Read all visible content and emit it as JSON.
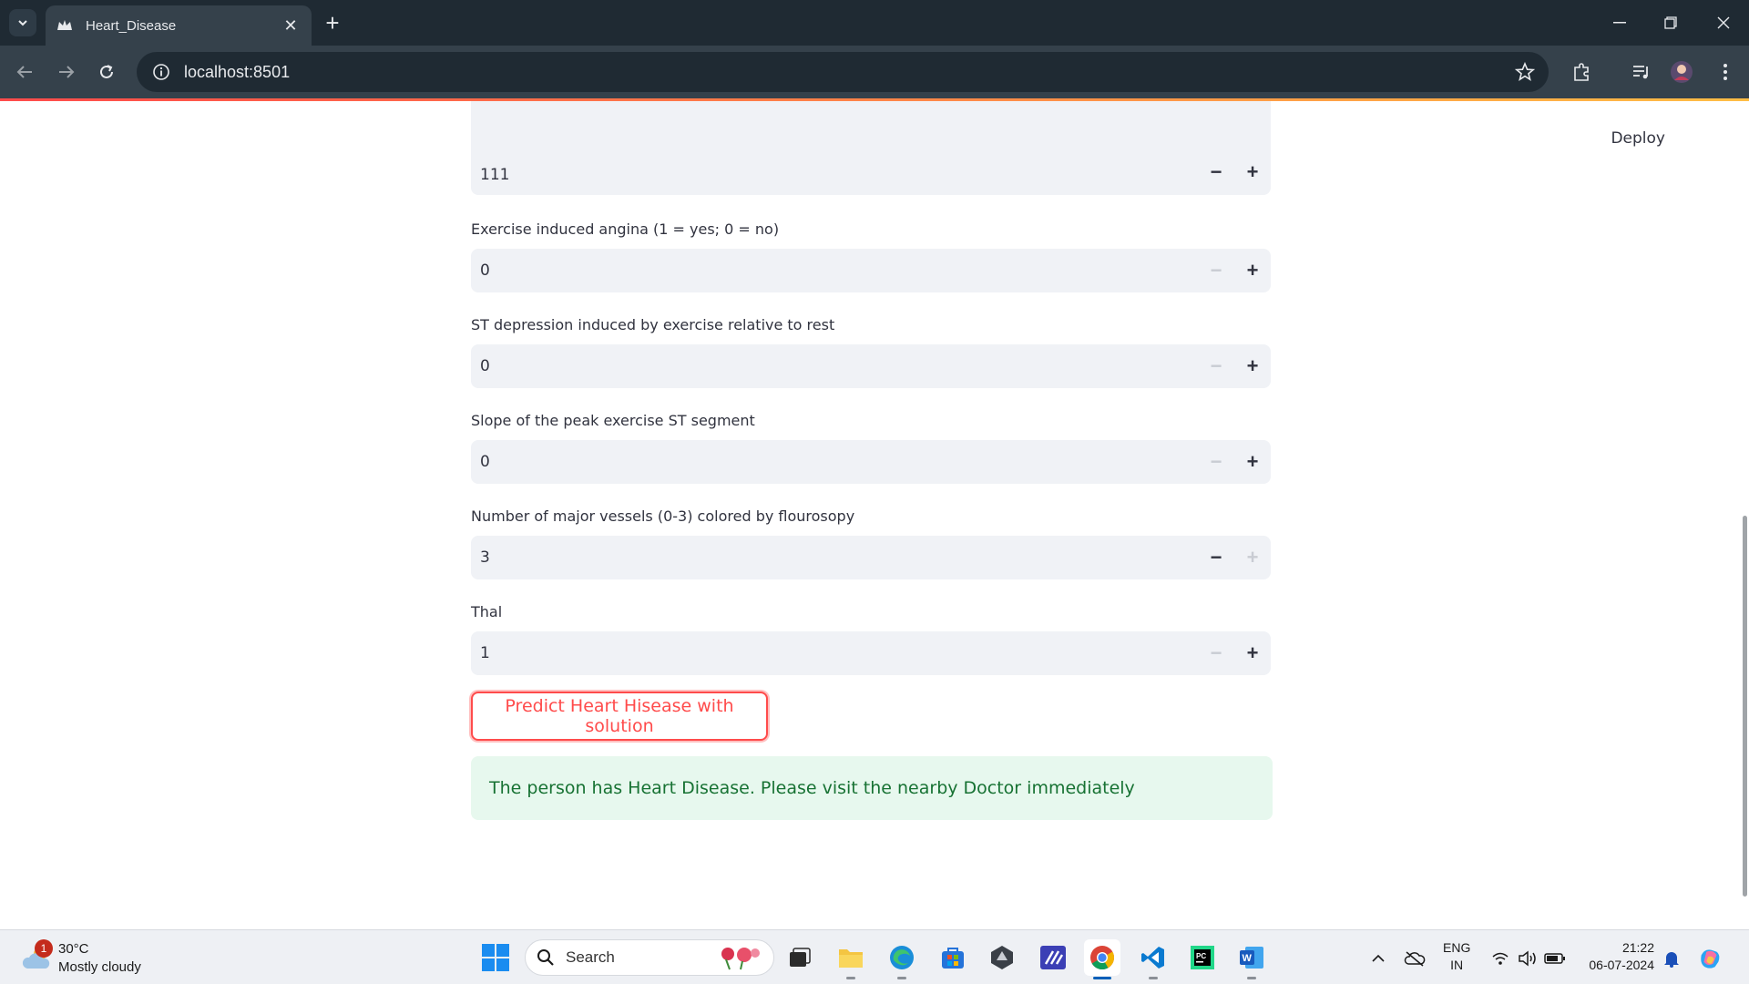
{
  "browser": {
    "tab_title": "Heart_Disease",
    "url": "localhost:8501"
  },
  "app": {
    "deploy_label": "Deploy",
    "top_input_value": "111",
    "fields": [
      {
        "label": "Exercise induced angina (1 = yes; 0 = no)",
        "value": "0",
        "minus_disabled": true,
        "plus_disabled": false
      },
      {
        "label": "ST depression induced by exercise relative to rest",
        "value": "0",
        "minus_disabled": true,
        "plus_disabled": false
      },
      {
        "label": "Slope of the peak exercise ST segment",
        "value": "0",
        "minus_disabled": true,
        "plus_disabled": false
      },
      {
        "label": "Number of major vessels (0-3) colored by flourosopy",
        "value": "3",
        "minus_disabled": false,
        "plus_disabled": true
      },
      {
        "label": "Thal",
        "value": "1",
        "minus_disabled": true,
        "plus_disabled": false
      }
    ],
    "predict_button_label": "Predict Heart Hisease with solution",
    "result_message": "The person has Heart Disease. Please visit the nearby Doctor immediately",
    "accent_color": "#ff4b4b",
    "success_bg": "#e7f8ee",
    "success_text": "#177233"
  },
  "taskbar": {
    "weather_badge": "1",
    "weather_temp": "30°C",
    "weather_condition": "Mostly cloudy",
    "search_placeholder": "Search",
    "lang_line1": "ENG",
    "lang_line2": "IN",
    "time": "21:22",
    "date": "06-07-2024"
  }
}
